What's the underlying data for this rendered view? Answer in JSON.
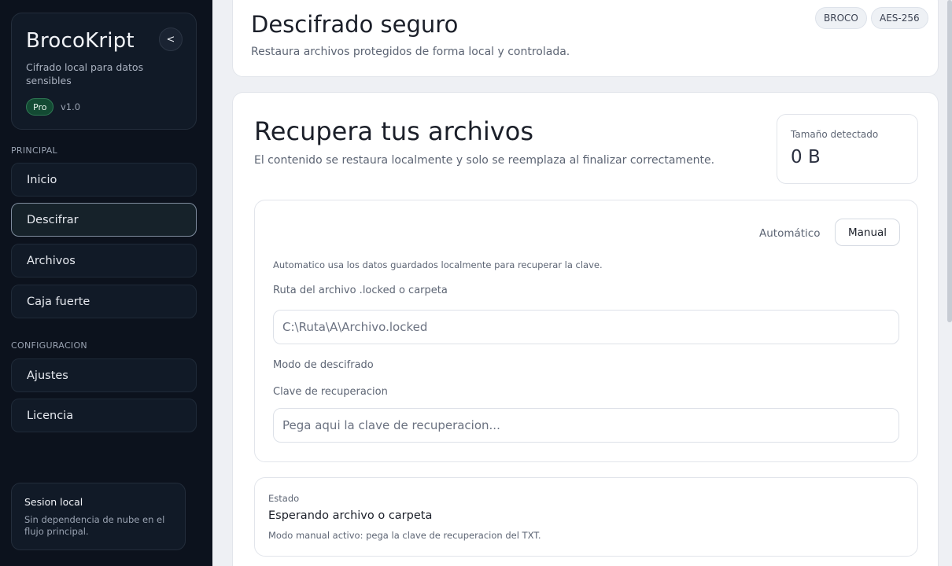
{
  "sidebar": {
    "brand": {
      "title": "BrocoKript",
      "subtitle": "Cifrado local para datos sensibles",
      "badge": "Pro",
      "version": "v1.0",
      "collapse_label": "<"
    },
    "sections": {
      "principal": "PRINCIPAL",
      "configuracion": "CONFIGURACION"
    },
    "items": [
      {
        "label": "Inicio"
      },
      {
        "label": "Descifrar"
      },
      {
        "label": "Archivos"
      },
      {
        "label": "Caja fuerte"
      },
      {
        "label": "Ajustes"
      },
      {
        "label": "Licencia"
      }
    ],
    "session": {
      "title": "Sesion local",
      "text": "Sin dependencia de nube en el flujo principal."
    }
  },
  "header": {
    "title": "Descifrado seguro",
    "subtitle": "Restaura archivos protegidos de forma local y controlada.",
    "tags": [
      "BROCO",
      "AES-256"
    ]
  },
  "main": {
    "title": "Recupera tus archivos",
    "subtitle": "El contenido se restaura localmente y solo se reemplaza al finalizar correctamente.",
    "size": {
      "label": "Tamaño detectado",
      "value": "0 B"
    },
    "form": {
      "mode_auto": "Automático",
      "mode_manual": "Manual",
      "hint": "Automatico usa los datos guardados localmente para recuperar la clave.",
      "path_label": "Ruta del archivo .locked o carpeta",
      "path_placeholder": "C:\\Ruta\\A\\Archivo.locked",
      "mode_label": "Modo de descifrado",
      "key_label": "Clave de recuperacion",
      "key_placeholder": "Pega aqui la clave de recuperacion..."
    },
    "status": {
      "label": "Estado",
      "value": "Esperando archivo o carpeta",
      "note": "Modo manual activo: pega la clave de recuperacion del TXT."
    }
  },
  "colors": {
    "sidebar_bg": "#0c121d",
    "accent_green": "#134a33",
    "page_bg": "#eef0f4"
  }
}
